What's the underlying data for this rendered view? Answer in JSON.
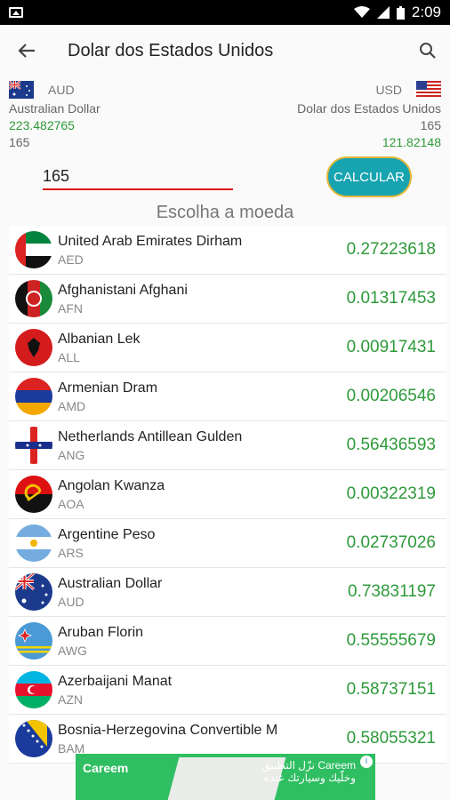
{
  "status_bar": {
    "time": "2:09"
  },
  "app_bar": {
    "title": "Dolar dos Estados Unidos"
  },
  "summary": {
    "from": {
      "code": "AUD",
      "name": "Australian Dollar",
      "rate": "223.482765",
      "amount": "165"
    },
    "to": {
      "code": "USD",
      "name": "Dolar dos Estados Unidos",
      "amount": "165",
      "result": "121.82148"
    }
  },
  "input": {
    "value": "165"
  },
  "calc_button": {
    "label": "CALCULAR"
  },
  "choose_label": "Escolha a moeda",
  "currencies": [
    {
      "name": "United Arab Emirates Dirham",
      "code": "AED",
      "value": "0.27223618"
    },
    {
      "name": "Afghanistani Afghani",
      "code": "AFN",
      "value": "0.01317453"
    },
    {
      "name": "Albanian Lek",
      "code": "ALL",
      "value": "0.00917431"
    },
    {
      "name": "Armenian Dram",
      "code": "AMD",
      "value": "0.00206546"
    },
    {
      "name": "Netherlands Antillean Gulden",
      "code": "ANG",
      "value": "0.56436593"
    },
    {
      "name": "Angolan Kwanza",
      "code": "AOA",
      "value": "0.00322319"
    },
    {
      "name": "Argentine Peso",
      "code": "ARS",
      "value": "0.02737026"
    },
    {
      "name": "Australian Dollar",
      "code": "AUD",
      "value": "0.73831197"
    },
    {
      "name": "Aruban Florin",
      "code": "AWG",
      "value": "0.55555679"
    },
    {
      "name": "Azerbaijani Manat",
      "code": "AZN",
      "value": "0.58737151"
    },
    {
      "name": "Bosnia-Herzegovina Convertible M",
      "code": "BAM",
      "value": "0.58055321"
    }
  ],
  "ad": {
    "brand": "Careem",
    "arabic_line1": "نزّل التطبيق Careem",
    "arabic_line2": "وخلّيك وسيارتك عنده"
  }
}
